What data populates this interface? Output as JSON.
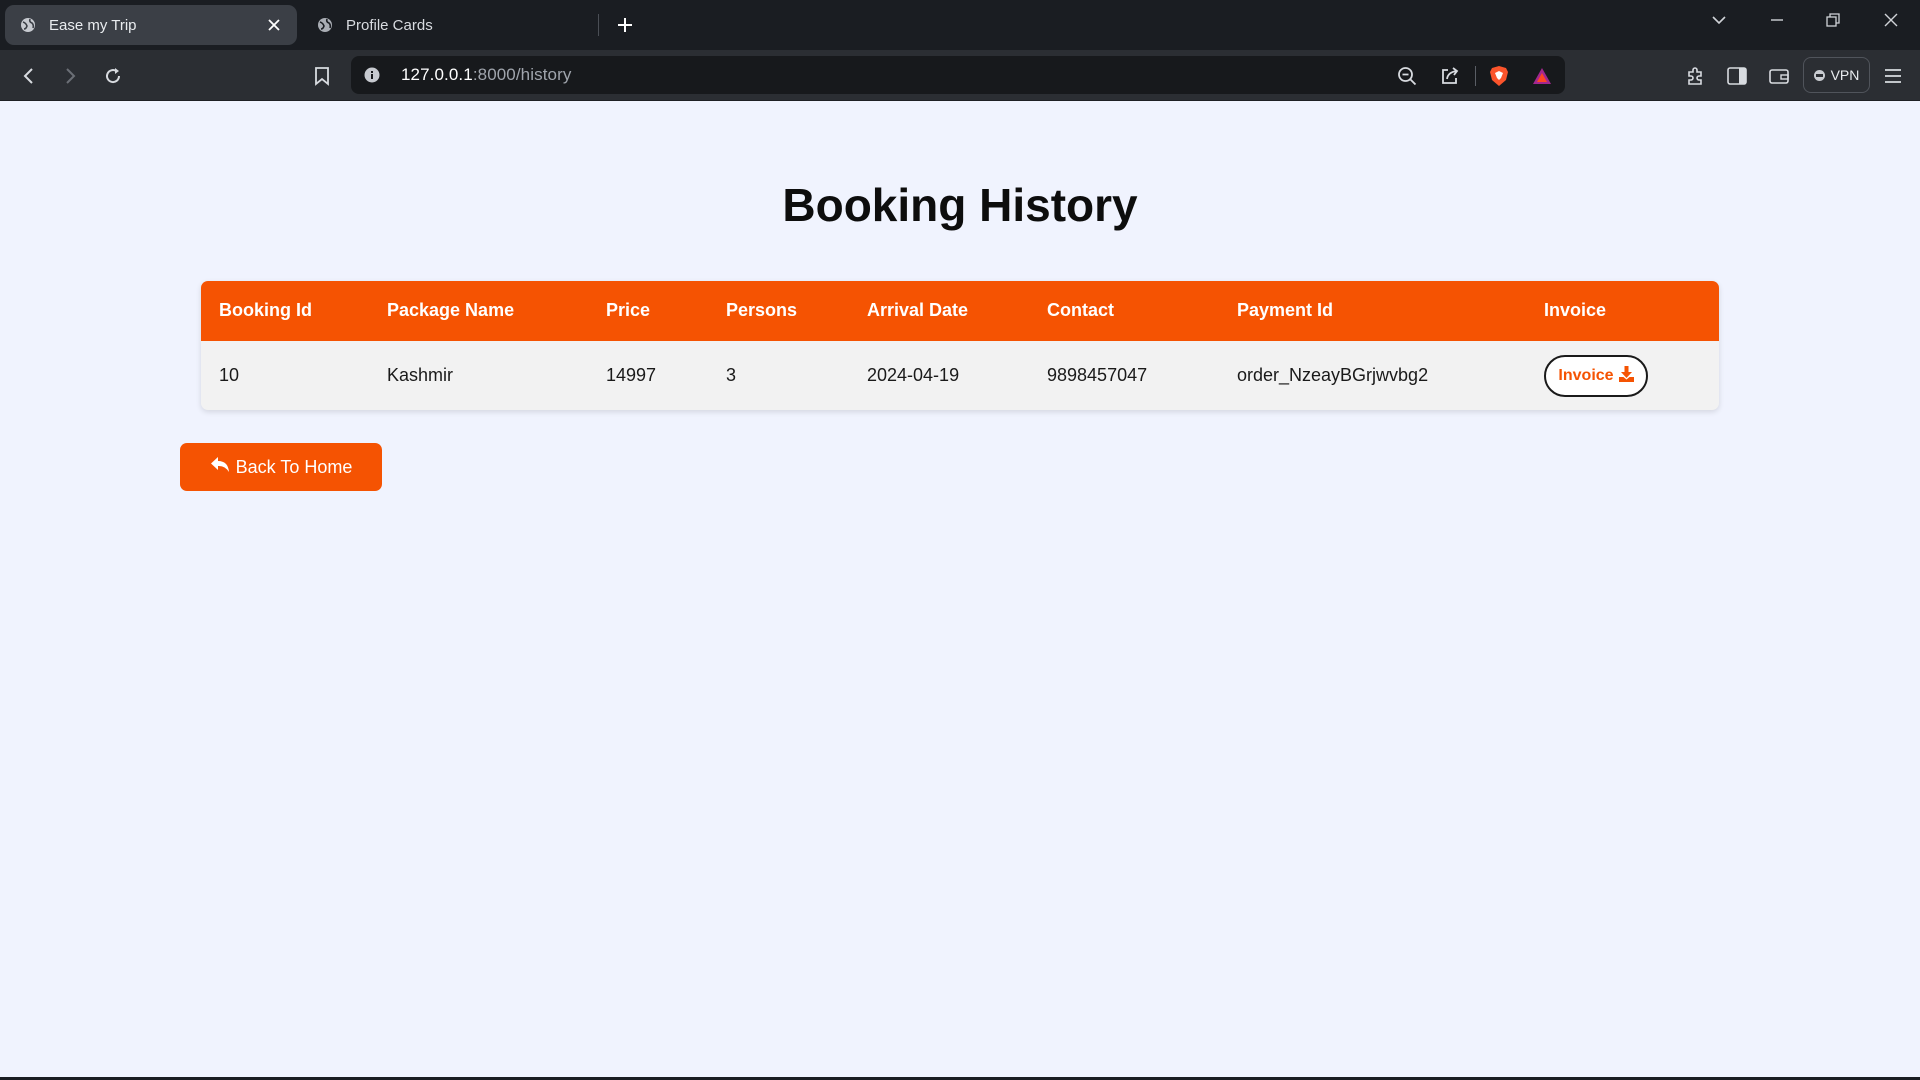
{
  "browser": {
    "tabs": [
      {
        "title": "Ease my Trip",
        "active": true
      },
      {
        "title": "Profile Cards",
        "active": false
      }
    ],
    "url": {
      "host": "127.0.0.1",
      "rest": ":8000/history"
    },
    "vpn_label": "VPN"
  },
  "page": {
    "title": "Booking History",
    "table": {
      "headers": [
        "Booking Id",
        "Package Name",
        "Price",
        "Persons",
        "Arrival Date",
        "Contact",
        "Payment Id",
        "Invoice"
      ],
      "rows": [
        {
          "booking_id": "10",
          "package_name": "Kashmir",
          "price": "14997",
          "persons": "3",
          "arrival_date": "2024-04-19",
          "contact": "9898457047",
          "payment_id": "order_NzeayBGrjwvbg2",
          "invoice_label": "Invoice"
        }
      ]
    },
    "back_button_label": "Back To Home"
  },
  "colors": {
    "accent": "#f55302",
    "page_bg": "#f0f3fe",
    "row_bg": "#f2f2f2"
  },
  "icons": [
    "globe-icon",
    "close-icon",
    "plus-icon",
    "chevron-down-icon",
    "minimize-icon",
    "restore-icon",
    "window-close-icon",
    "back-arrow-icon",
    "forward-arrow-icon",
    "reload-icon",
    "bookmark-icon",
    "info-icon",
    "zoom-out-icon",
    "share-icon",
    "brave-shield-icon",
    "brave-rewards-icon",
    "extensions-icon",
    "sidebar-icon",
    "wallet-icon",
    "menu-icon",
    "download-icon",
    "reply-icon"
  ]
}
